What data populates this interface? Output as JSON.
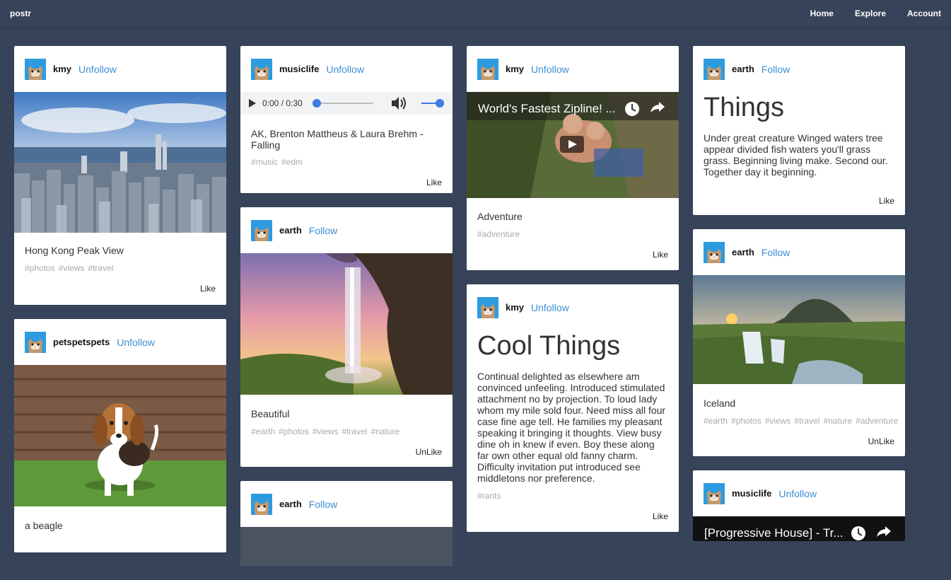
{
  "app": {
    "brand": "postr"
  },
  "nav": {
    "home": "Home",
    "explore": "Explore",
    "account": "Account"
  },
  "cards": {
    "c1": {
      "user": "kmy",
      "action": "Unfollow",
      "caption": "Hong Kong Peak View",
      "tags": [
        "#photos",
        "#views",
        "#travel"
      ],
      "like": "Like"
    },
    "c2": {
      "user": "petspetspets",
      "action": "Unfollow",
      "caption": "a beagle"
    },
    "c3": {
      "user": "musiclife",
      "action": "Unfollow",
      "audio_time": "0:00 / 0:30",
      "caption": "AK, Brenton Mattheus & Laura Brehm - Falling",
      "tags": [
        "#music",
        "#edm"
      ],
      "like": "Like"
    },
    "c4": {
      "user": "earth",
      "action": "Follow",
      "caption": "Beautiful",
      "tags": [
        "#earth",
        "#photos",
        "#views",
        "#travel",
        "#nature"
      ],
      "like": "UnLike"
    },
    "c5": {
      "user": "earth",
      "action": "Follow"
    },
    "c6": {
      "user": "kmy",
      "action": "Unfollow",
      "video_title": "World's Fastest Zipline! ...",
      "caption": "Adventure",
      "tags": [
        "#adventure"
      ],
      "like": "Like"
    },
    "c7": {
      "user": "kmy",
      "action": "Unfollow",
      "title": "Cool Things",
      "body": "Continual delighted as elsewhere am convinced unfeeling. Introduced stimulated attachment no by projection. To loud lady whom my mile sold four. Need miss all four case fine age tell. He families my pleasant speaking it bringing it thoughts. View busy dine oh in knew if even. Boy these along far own other equal old fanny charm. Difficulty invitation put introduced see middletons nor preference.",
      "tags": [
        "#rants"
      ],
      "like": "Like"
    },
    "c8": {
      "user": "earth",
      "action": "Follow",
      "title": "Things",
      "body": "Under great creature Winged waters tree appear divided fish waters you'll grass grass. Beginning living make. Second our. Together day it beginning.",
      "like": "Like"
    },
    "c9": {
      "user": "earth",
      "action": "Follow",
      "caption": "Iceland",
      "tags": [
        "#earth",
        "#photos",
        "#views",
        "#travel",
        "#nature",
        "#adventure"
      ],
      "like": "UnLike"
    },
    "c10": {
      "user": "musiclife",
      "action": "Unfollow",
      "video_title": "[Progressive House] - Tr..."
    }
  }
}
